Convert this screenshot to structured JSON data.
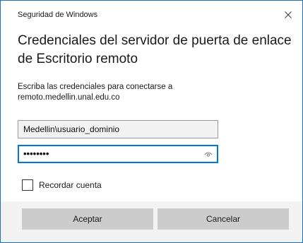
{
  "window": {
    "title": "Seguridad de Windows",
    "close_icon": "close-icon"
  },
  "heading": {
    "line1": "Credenciales del servidor de puerta de enlace",
    "line2": "de Escritorio remoto"
  },
  "description": {
    "line1": "Escriba las credenciales para conectarse a",
    "line2": "remoto.medellin.unal.edu.co"
  },
  "username": {
    "value": "Medellin\\usuario_dominio"
  },
  "password": {
    "value": "••••••••",
    "reveal_icon": "eye-icon"
  },
  "remember": {
    "label": "Recordar cuenta",
    "checked": false
  },
  "buttons": {
    "ok_label": "Aceptar",
    "cancel_label": "Cancelar"
  },
  "colors": {
    "accent": "#0078d7",
    "border": "#1f6fbf",
    "button_bg": "#cccccc",
    "footer_bg": "#f2f2f2"
  }
}
